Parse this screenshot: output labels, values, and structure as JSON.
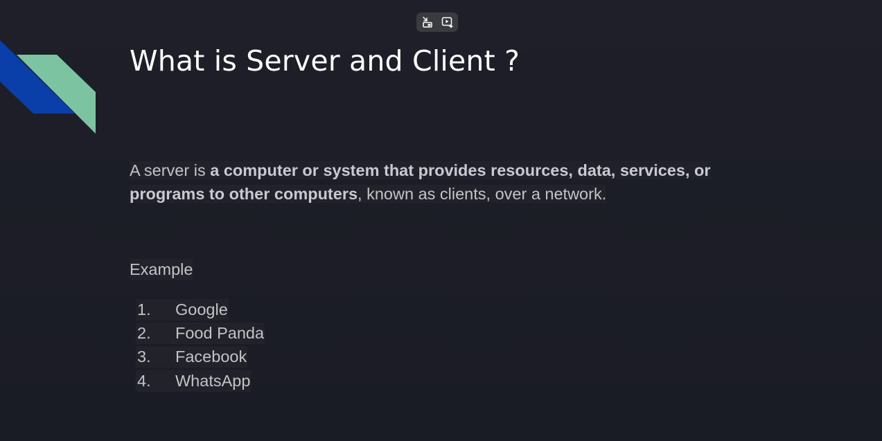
{
  "toolbar": {
    "buttons": [
      {
        "icon": "exit-fullscreen-icon"
      },
      {
        "icon": "play-sparkle-icon"
      }
    ]
  },
  "slide": {
    "title": "What is Server and Client ?",
    "definition": {
      "prefix": "A server is ",
      "bold": "a computer or system that provides resources, data, services, or programs to other computers",
      "suffix": ", known as clients, over a network."
    },
    "example_label": "Example",
    "examples": [
      {
        "number": "1.",
        "text": "Google"
      },
      {
        "number": "2.",
        "text": "Food Panda"
      },
      {
        "number": "3.",
        "text": "Facebook"
      },
      {
        "number": "4.",
        "text": "WhatsApp"
      }
    ]
  },
  "colors": {
    "background": "#1b1d26",
    "deco_blue": "#0a3ea8",
    "deco_green": "#7cc3a1",
    "title": "#ffffff",
    "body_text": "#c3c4c8"
  }
}
